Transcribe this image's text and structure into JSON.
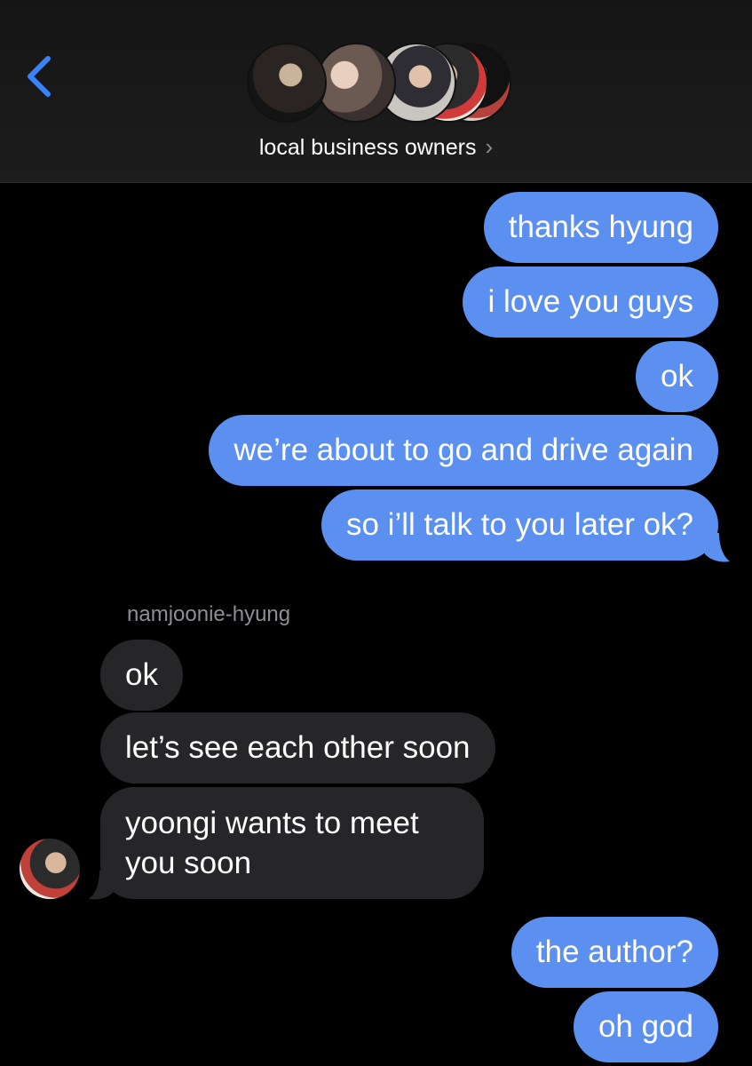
{
  "header": {
    "back_icon": "chevron-left-icon",
    "group_name": "local business owners",
    "chevron": "›",
    "avatars": [
      "member-avatar-1",
      "member-avatar-2",
      "member-avatar-3",
      "member-avatar-4",
      "member-avatar-5"
    ]
  },
  "colors": {
    "outgoing": "#5b8ff0",
    "incoming": "#262629",
    "accent": "#3a82f7"
  },
  "messages": {
    "out1": "thanks hyung",
    "out2": "i love you guys",
    "out3": "ok",
    "out4": "we’re about to go and drive again",
    "out5": "so i’ll talk to you later ok?",
    "sender": "namjoonie-hyung",
    "in1": "ok",
    "in2": "let’s see each other soon",
    "in3_line1": "yoongi wants to meet",
    "in3_line2": "you soon",
    "out6": "the author?",
    "out7": "oh god"
  }
}
